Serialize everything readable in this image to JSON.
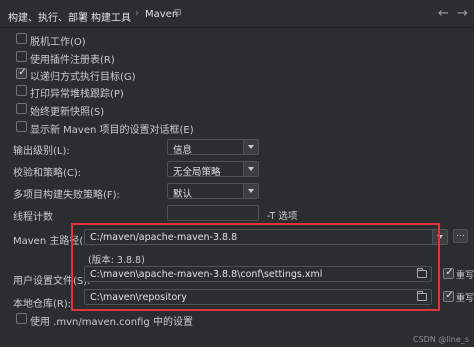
{
  "breadcrumb": {
    "parent": "构建、执行、部署",
    "middle": "构建工具",
    "current": "Maven",
    "separator": "›"
  },
  "nav": {
    "back": "←",
    "forward": "→"
  },
  "checkboxes": {
    "offline": {
      "label": "脱机工作(O)",
      "checked": false
    },
    "plugin_registry": {
      "label": "使用插件注册表(R)",
      "checked": false
    },
    "recursive": {
      "label": "以递归方式执行目标(G)",
      "checked": true
    },
    "print_stack": {
      "label": "打印异常堆栈跟踪(P)",
      "checked": false
    },
    "always_update": {
      "label": "始终更新快照(S)",
      "checked": false
    },
    "show_settings": {
      "label": "显示新 Maven 项目的设置对话框(E)",
      "checked": false
    },
    "use_mvn_config": {
      "label": "使用 .mvn/maven.config 中的设置",
      "checked": false
    }
  },
  "fields": {
    "output_level": {
      "label": "输出级别(L):",
      "value": "信息"
    },
    "checksum_policy": {
      "label": "校验和策略(C):",
      "value": "无全局策略"
    },
    "multiproject_fail": {
      "label": "多项目构建失败策略(F):",
      "value": "默认"
    },
    "thread_count": {
      "label": "线程计数",
      "value": "",
      "suffix": "-T 选项"
    },
    "maven_home": {
      "label": "Maven 主路径(H):",
      "value": "C:/maven/apache-maven-3.8.8",
      "version": "(版本: 3.8.8)",
      "more": "..."
    },
    "user_settings": {
      "label": "用户设置文件(S):",
      "value": "C:\\maven\\apache-maven-3.8.8\\conf\\settings.xml",
      "override_label": "重写",
      "override_checked": true
    },
    "local_repo": {
      "label": "本地仓库(R):",
      "value": "C:\\maven\\repository",
      "override_label": "重写",
      "override_checked": true
    }
  },
  "watermark": "CSDN @line_s",
  "highlight_color": "#e0343a"
}
